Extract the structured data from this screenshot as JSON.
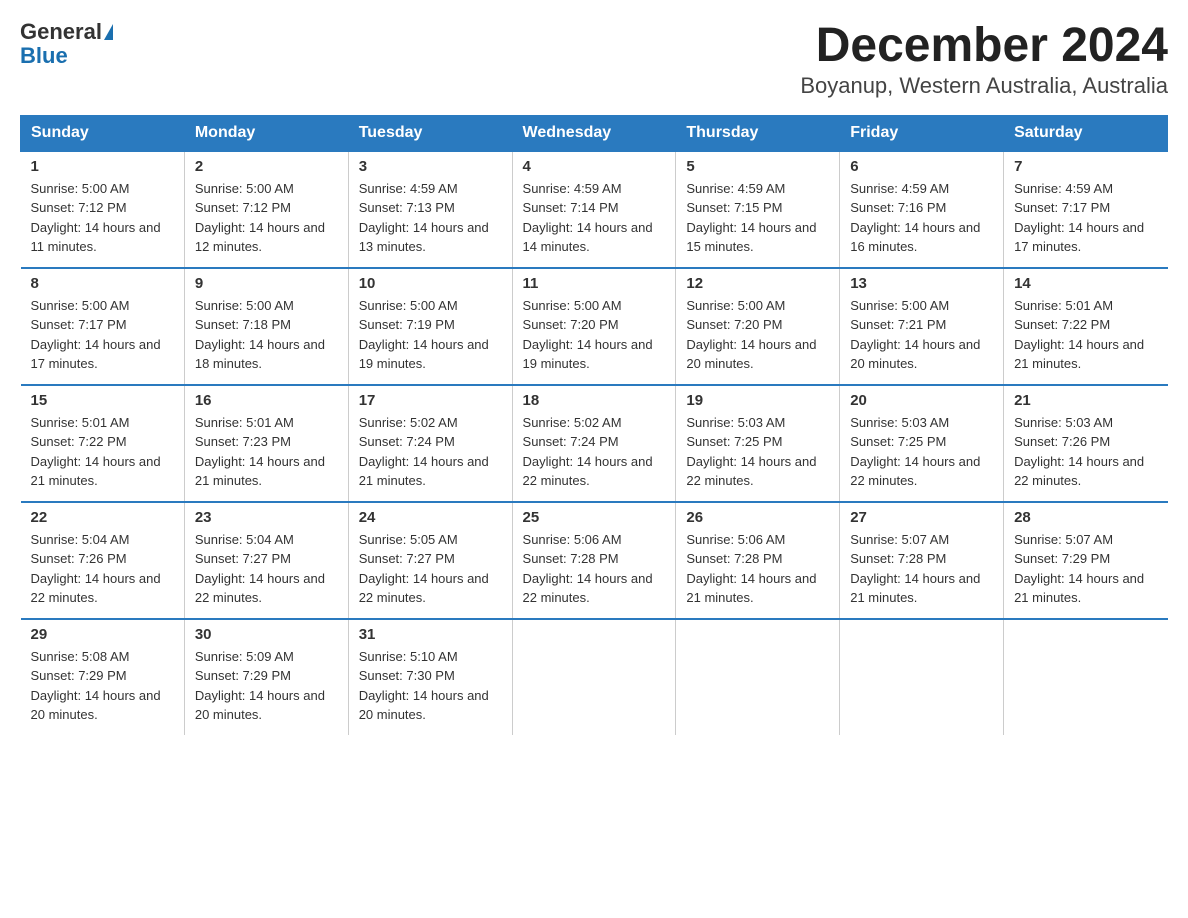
{
  "header": {
    "logo_general": "General",
    "logo_blue": "Blue",
    "title": "December 2024",
    "subtitle": "Boyanup, Western Australia, Australia"
  },
  "columns": [
    "Sunday",
    "Monday",
    "Tuesday",
    "Wednesday",
    "Thursday",
    "Friday",
    "Saturday"
  ],
  "weeks": [
    [
      {
        "day": "1",
        "sunrise": "5:00 AM",
        "sunset": "7:12 PM",
        "daylight": "14 hours and 11 minutes."
      },
      {
        "day": "2",
        "sunrise": "5:00 AM",
        "sunset": "7:12 PM",
        "daylight": "14 hours and 12 minutes."
      },
      {
        "day": "3",
        "sunrise": "4:59 AM",
        "sunset": "7:13 PM",
        "daylight": "14 hours and 13 minutes."
      },
      {
        "day": "4",
        "sunrise": "4:59 AM",
        "sunset": "7:14 PM",
        "daylight": "14 hours and 14 minutes."
      },
      {
        "day": "5",
        "sunrise": "4:59 AM",
        "sunset": "7:15 PM",
        "daylight": "14 hours and 15 minutes."
      },
      {
        "day": "6",
        "sunrise": "4:59 AM",
        "sunset": "7:16 PM",
        "daylight": "14 hours and 16 minutes."
      },
      {
        "day": "7",
        "sunrise": "4:59 AM",
        "sunset": "7:17 PM",
        "daylight": "14 hours and 17 minutes."
      }
    ],
    [
      {
        "day": "8",
        "sunrise": "5:00 AM",
        "sunset": "7:17 PM",
        "daylight": "14 hours and 17 minutes."
      },
      {
        "day": "9",
        "sunrise": "5:00 AM",
        "sunset": "7:18 PM",
        "daylight": "14 hours and 18 minutes."
      },
      {
        "day": "10",
        "sunrise": "5:00 AM",
        "sunset": "7:19 PM",
        "daylight": "14 hours and 19 minutes."
      },
      {
        "day": "11",
        "sunrise": "5:00 AM",
        "sunset": "7:20 PM",
        "daylight": "14 hours and 19 minutes."
      },
      {
        "day": "12",
        "sunrise": "5:00 AM",
        "sunset": "7:20 PM",
        "daylight": "14 hours and 20 minutes."
      },
      {
        "day": "13",
        "sunrise": "5:00 AM",
        "sunset": "7:21 PM",
        "daylight": "14 hours and 20 minutes."
      },
      {
        "day": "14",
        "sunrise": "5:01 AM",
        "sunset": "7:22 PM",
        "daylight": "14 hours and 21 minutes."
      }
    ],
    [
      {
        "day": "15",
        "sunrise": "5:01 AM",
        "sunset": "7:22 PM",
        "daylight": "14 hours and 21 minutes."
      },
      {
        "day": "16",
        "sunrise": "5:01 AM",
        "sunset": "7:23 PM",
        "daylight": "14 hours and 21 minutes."
      },
      {
        "day": "17",
        "sunrise": "5:02 AM",
        "sunset": "7:24 PM",
        "daylight": "14 hours and 21 minutes."
      },
      {
        "day": "18",
        "sunrise": "5:02 AM",
        "sunset": "7:24 PM",
        "daylight": "14 hours and 22 minutes."
      },
      {
        "day": "19",
        "sunrise": "5:03 AM",
        "sunset": "7:25 PM",
        "daylight": "14 hours and 22 minutes."
      },
      {
        "day": "20",
        "sunrise": "5:03 AM",
        "sunset": "7:25 PM",
        "daylight": "14 hours and 22 minutes."
      },
      {
        "day": "21",
        "sunrise": "5:03 AM",
        "sunset": "7:26 PM",
        "daylight": "14 hours and 22 minutes."
      }
    ],
    [
      {
        "day": "22",
        "sunrise": "5:04 AM",
        "sunset": "7:26 PM",
        "daylight": "14 hours and 22 minutes."
      },
      {
        "day": "23",
        "sunrise": "5:04 AM",
        "sunset": "7:27 PM",
        "daylight": "14 hours and 22 minutes."
      },
      {
        "day": "24",
        "sunrise": "5:05 AM",
        "sunset": "7:27 PM",
        "daylight": "14 hours and 22 minutes."
      },
      {
        "day": "25",
        "sunrise": "5:06 AM",
        "sunset": "7:28 PM",
        "daylight": "14 hours and 22 minutes."
      },
      {
        "day": "26",
        "sunrise": "5:06 AM",
        "sunset": "7:28 PM",
        "daylight": "14 hours and 21 minutes."
      },
      {
        "day": "27",
        "sunrise": "5:07 AM",
        "sunset": "7:28 PM",
        "daylight": "14 hours and 21 minutes."
      },
      {
        "day": "28",
        "sunrise": "5:07 AM",
        "sunset": "7:29 PM",
        "daylight": "14 hours and 21 minutes."
      }
    ],
    [
      {
        "day": "29",
        "sunrise": "5:08 AM",
        "sunset": "7:29 PM",
        "daylight": "14 hours and 20 minutes."
      },
      {
        "day": "30",
        "sunrise": "5:09 AM",
        "sunset": "7:29 PM",
        "daylight": "14 hours and 20 minutes."
      },
      {
        "day": "31",
        "sunrise": "5:10 AM",
        "sunset": "7:30 PM",
        "daylight": "14 hours and 20 minutes."
      },
      null,
      null,
      null,
      null
    ]
  ]
}
